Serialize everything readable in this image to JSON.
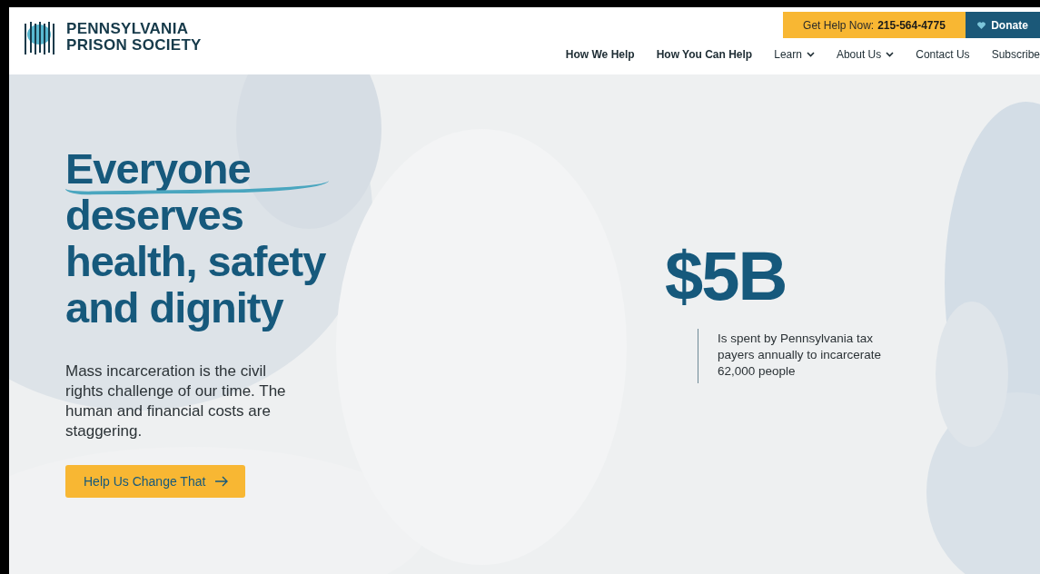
{
  "header": {
    "logo": {
      "line_1": "PENNSYLVANIA",
      "line_2": "PRISON SOCIETY"
    },
    "help": {
      "label": "Get Help Now:",
      "phone": "215-564-4775"
    },
    "donate": "Donate",
    "nav": [
      {
        "label": "How We Help",
        "kind": "primary"
      },
      {
        "label": "How You Can Help",
        "kind": "primary"
      },
      {
        "label": "Learn",
        "kind": "dropdown"
      },
      {
        "label": "About Us",
        "kind": "dropdown"
      },
      {
        "label": "Contact Us",
        "kind": "link"
      },
      {
        "label": "Subscribe",
        "kind": "link"
      }
    ]
  },
  "hero": {
    "headline": [
      {
        "text": "Everyone",
        "underlined": true
      },
      {
        "text": "deserves",
        "underlined": false
      },
      {
        "text": "health, safety",
        "underlined": false
      },
      {
        "text": "and dignity",
        "underlined": false
      }
    ],
    "intro": "Mass incarceration is the civil rights challenge of our time. The human and financial costs are staggering.",
    "cta": "Help Us Change That",
    "stat": {
      "value": "$5B",
      "caption": "Is spent by Pennsylvania tax payers annually to incarcerate 62,000 people"
    }
  }
}
